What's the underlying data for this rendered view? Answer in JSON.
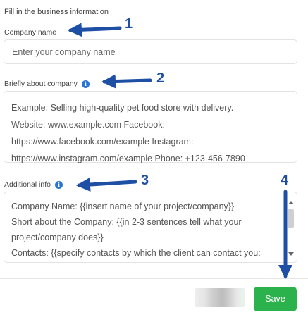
{
  "form": {
    "section_title": "Fill in the business information",
    "company_name": {
      "label": "Company name",
      "placeholder": "Enter your company name"
    },
    "about_company": {
      "label": "Briefly about company",
      "info_icon": "info-icon",
      "lines": [
        "Example: Selling high-quality pet food store with delivery.",
        "Website: www.example.com Facebook:",
        "https://www.facebook.com/example Instagram:",
        "https://www.instagram.com/example Phone: +123-456-7890"
      ]
    },
    "additional_info": {
      "label": "Additional info",
      "info_icon": "info-icon",
      "lines": [
        "Company Name: {{insert name of your project/company}}",
        "Short about the Company: {{in 2-3 sentences tell what your",
        "project/company does}}",
        "Contacts: {{specify contacts by which the client can contact you:"
      ]
    }
  },
  "footer": {
    "save_label": "Save"
  },
  "annotations": {
    "numbers": [
      "1",
      "2",
      "3",
      "4"
    ],
    "arrow_color": "#1d4fa5"
  },
  "colors": {
    "save_button": "#2bb24c",
    "info_icon": "#2a74d6"
  }
}
